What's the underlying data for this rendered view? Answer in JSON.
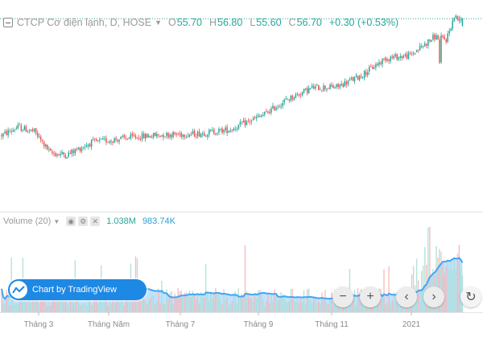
{
  "legend": {
    "symbol": "CTCP Cơ điện lạnh, D, HOSE",
    "open_label": "O",
    "open": "55.70",
    "high_label": "H",
    "high": "56.80",
    "low_label": "L",
    "low": "55.60",
    "close_label": "C",
    "close": "56.70",
    "change": "+0.30 (+0.53%)"
  },
  "volume_legend": {
    "name": "Volume (20)",
    "value": "1.038M",
    "ma_value": "983.74K",
    "icons": [
      "eye-icon",
      "settings-icon",
      "close-icon"
    ]
  },
  "watermark": {
    "text": "Chart by TradingView"
  },
  "controls": {
    "zoom_out": "−",
    "zoom_in": "+",
    "scroll_left": "‹",
    "scroll_right": "›",
    "reset": "↻"
  },
  "colors": {
    "up": "#26a69a",
    "down": "#ef5350",
    "vol_up": "#a8ddd5",
    "vol_down": "#f6b3b0",
    "vol_ma_line": "#42a5f5",
    "vol_ma_fill": "#90caf9",
    "last_price_line": "#26a69a"
  },
  "chart_data": {
    "type": "candlestick",
    "x_tick_labels": [
      "Tháng 3",
      "Tháng Năm",
      "Tháng 7",
      "Tháng 9",
      "Tháng 11",
      "2021"
    ],
    "price_range": [
      30,
      57.5
    ],
    "price_anchors": [
      [
        0,
        40.5
      ],
      [
        10,
        41.6
      ],
      [
        20,
        41
      ],
      [
        30,
        38
      ],
      [
        40,
        37.8
      ],
      [
        55,
        39.5
      ],
      [
        80,
        40.2
      ],
      [
        100,
        40.6
      ],
      [
        120,
        40.7
      ],
      [
        140,
        41.3
      ],
      [
        160,
        43.3
      ],
      [
        175,
        45.5
      ],
      [
        190,
        47.1
      ],
      [
        205,
        47.2
      ],
      [
        220,
        48.8
      ],
      [
        235,
        51.2
      ],
      [
        250,
        51.6
      ],
      [
        265,
        54.2
      ],
      [
        272,
        53.8
      ],
      [
        277,
        56.9
      ],
      [
        282,
        56.7
      ]
    ],
    "last": {
      "open": 55.7,
      "high": 56.8,
      "low": 55.6,
      "close": 56.7,
      "change": 0.3,
      "change_pct": 0.53
    },
    "volume_ma_period": 20,
    "volume_last": 1038000,
    "volume_ma_last": 983740
  }
}
